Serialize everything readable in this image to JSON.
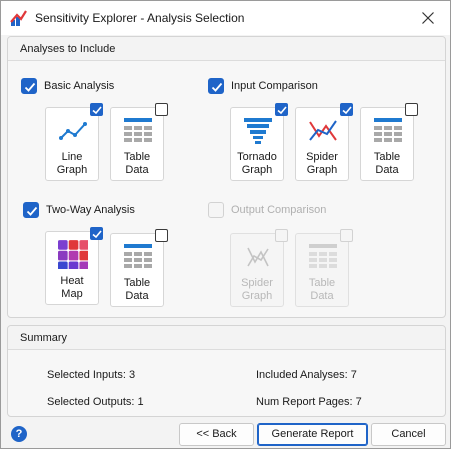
{
  "window": {
    "title": "Sensitivity Explorer - Analysis Selection"
  },
  "analyses": {
    "header": "Analyses to Include",
    "groups": {
      "basic": {
        "label": "Basic Analysis",
        "checked": true,
        "tiles": [
          {
            "label": "Line\nGraph",
            "icon": "line-graph-icon",
            "checked": true
          },
          {
            "label": "Table\nData",
            "icon": "table-data-icon",
            "checked": false
          }
        ]
      },
      "input": {
        "label": "Input Comparison",
        "checked": true,
        "tiles": [
          {
            "label": "Tornado\nGraph",
            "icon": "tornado-graph-icon",
            "checked": true
          },
          {
            "label": "Spider\nGraph",
            "icon": "spider-graph-icon",
            "checked": true
          },
          {
            "label": "Table\nData",
            "icon": "table-data-icon",
            "checked": false
          }
        ]
      },
      "twoway": {
        "label": "Two-Way Analysis",
        "checked": true,
        "tiles": [
          {
            "label": "Heat\nMap",
            "icon": "heat-map-icon",
            "checked": true
          },
          {
            "label": "Table\nData",
            "icon": "table-data-icon",
            "checked": false
          }
        ]
      },
      "output": {
        "label": "Output Comparison",
        "checked": false,
        "disabled": true,
        "tiles": [
          {
            "label": "Spider\nGraph",
            "icon": "spider-graph-icon",
            "checked": false,
            "disabled": true
          },
          {
            "label": "Table\nData",
            "icon": "table-data-icon",
            "checked": false,
            "disabled": true
          }
        ]
      }
    }
  },
  "summary": {
    "header": "Summary",
    "selected_inputs": "Selected Inputs: 3",
    "selected_outputs": "Selected Outputs: 1",
    "included_analyses": "Included Analyses: 7",
    "num_report_pages": "Num Report Pages: 7"
  },
  "footer": {
    "help": "?",
    "back": "<< Back",
    "generate": "Generate Report",
    "cancel": "Cancel"
  },
  "colors": {
    "accent": "#1f64c8",
    "tile_icon_blue": "#1f7ad0",
    "table_grey": "#a9a9a9",
    "spider_red": "#e0383a",
    "spider_blue": "#1f64c8",
    "app_icon_red": "#e0383a"
  }
}
